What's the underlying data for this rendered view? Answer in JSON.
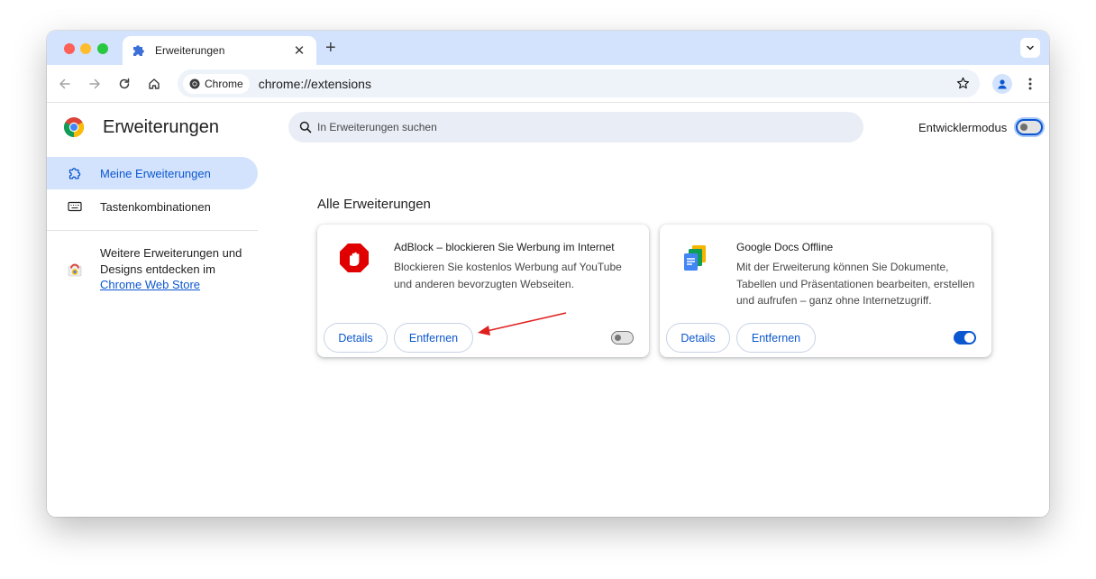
{
  "browser": {
    "tab_title": "Erweiterungen",
    "new_tab": "+",
    "close": "✕",
    "site_chip": "Chrome",
    "url": "chrome://extensions"
  },
  "header": {
    "title": "Erweiterungen",
    "search_placeholder": "In Erweiterungen suchen",
    "developer_mode_label": "Entwicklermodus",
    "developer_mode_on": false
  },
  "sidebar": {
    "items": [
      {
        "label": "Meine Erweiterungen",
        "icon": "puzzle-icon",
        "active": true
      },
      {
        "label": "Tastenkombinationen",
        "icon": "keyboard-icon",
        "active": false
      }
    ],
    "promo_text": "Weitere Erweiterungen und Designs entdecken im",
    "promo_link": "Chrome Web Store"
  },
  "main": {
    "section_title": "Alle Erweiterungen",
    "extensions": [
      {
        "name": "AdBlock – blockieren Sie Werbung im Internet",
        "description": "Blockieren Sie kostenlos Werbung auf YouTube und anderen bevorzugten Webseiten.",
        "details_label": "Details",
        "remove_label": "Entfernen",
        "enabled": false,
        "icon": "adblock-stop-hand-icon"
      },
      {
        "name": "Google Docs Offline",
        "description": "Mit der Erweiterung können Sie Dokumente, Tabellen und Präsentationen bearbeiten, erstellen und aufrufen – ganz ohne Internetzugriff.",
        "details_label": "Details",
        "remove_label": "Entfernen",
        "enabled": true,
        "icon": "google-docs-offline-icon"
      }
    ]
  },
  "colors": {
    "accent": "#0b57d0",
    "tabstrip": "#d3e3fd",
    "annotation_arrow": "#e0201f",
    "adblock_red": "#e00000"
  }
}
